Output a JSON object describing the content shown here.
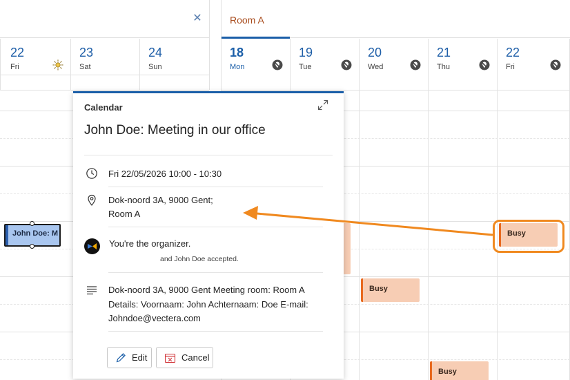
{
  "left_panel": {
    "days": [
      {
        "num": "22",
        "name": "Fri",
        "icon": "sun-icon"
      },
      {
        "num": "23",
        "name": "Sat"
      },
      {
        "num": "24",
        "name": "Sun"
      }
    ],
    "event_label": "John Doe: M"
  },
  "room": {
    "tab_label": "Room A",
    "days": [
      {
        "num": "18",
        "name": "Mon",
        "icon": "location-off-icon",
        "today": true
      },
      {
        "num": "19",
        "name": "Tue",
        "icon": "location-off-icon"
      },
      {
        "num": "20",
        "name": "Wed",
        "icon": "location-off-icon"
      },
      {
        "num": "21",
        "name": "Thu",
        "icon": "location-off-icon"
      },
      {
        "num": "22",
        "name": "Fri",
        "icon": "location-off-icon"
      }
    ],
    "busy_label": "Busy"
  },
  "popup": {
    "label": "Calendar",
    "title": "John Doe: Meeting in our office",
    "datetime": "Fri 22/05/2026 10:00 - 10:30",
    "location_line1": "Dok-noord 3A, 9000 Gent;",
    "location_line2": "Room A",
    "organizer": "You're the organizer.",
    "accepted": "and John Doe accepted.",
    "description_line1": "Dok-noord 3A, 9000 Gent Meeting room: Room A",
    "description_line2": "Details: Voornaam: John Achternaam: Doe E-mail:",
    "description_line3": "Johndoe@vectera.com",
    "edit_label": "Edit",
    "cancel_label": "Cancel"
  },
  "colors": {
    "accent": "#1a5ea8",
    "busy_fill": "#f7cdb4",
    "busy_bar": "#e8691e",
    "callout": "#f0891f",
    "event_fill": "#a9c6ef"
  }
}
